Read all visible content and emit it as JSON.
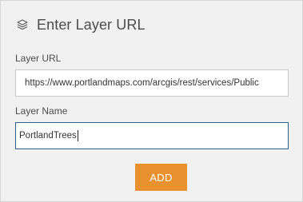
{
  "header": {
    "icon": "layers-icon",
    "title": "Enter Layer URL"
  },
  "form": {
    "url_label": "Layer URL",
    "url_value": "https://www.portlandmaps.com/arcgis/rest/services/Public",
    "name_label": "Layer Name",
    "name_value": "PortlandTrees",
    "add_label": "ADD"
  },
  "colors": {
    "accent": "#e8912e",
    "focus_border": "#2f5f8f",
    "panel_bg": "#f1f1f1"
  }
}
